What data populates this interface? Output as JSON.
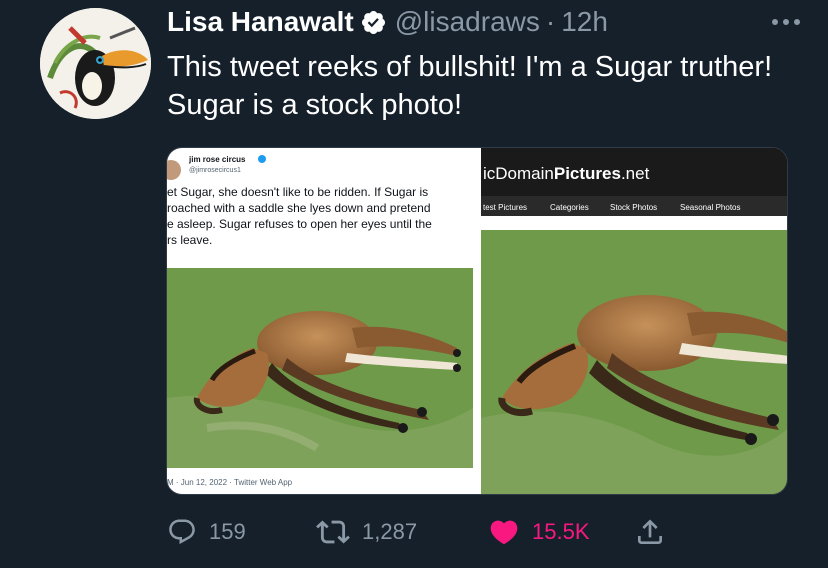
{
  "author": {
    "display_name": "Lisa Hanawalt",
    "handle": "@lisadraws",
    "separator": "·",
    "time": "12h"
  },
  "tweet": {
    "text": "This tweet reeks of bullshit! I'm a Sugar truther! Sugar is a stock photo!"
  },
  "media": {
    "left_panel": {
      "quoted_name": "jim rose circus",
      "quoted_handle": "@jimrosecircus1",
      "quoted_text_lines": [
        "et Sugar, she doesn't like to be ridden. If Sugar is",
        "roached with a saddle she lyes down and pretend",
        "e asleep. Sugar refuses to open her eyes until the",
        "rs leave."
      ],
      "footer": "M · Jun 12, 2022 · Twitter Web App"
    },
    "right_panel": {
      "site_title_prefix": "icDomain",
      "site_title_bold": "Pictures",
      "site_title_suffix": ".net",
      "nav_items": [
        "test Pictures",
        "Categories",
        "Stock Photos",
        "Seasonal Photos"
      ]
    }
  },
  "actions": {
    "reply_count": "159",
    "retweet_count": "1,287",
    "like_count": "15.5K"
  },
  "colors": {
    "background": "#15202b",
    "text": "#ffffff",
    "secondary": "#8b98a5",
    "like": "#f91880",
    "verified": "#1d9bf0"
  },
  "icons": {
    "verified": "verified-badge-icon",
    "more": "more-horizontal-icon",
    "reply": "reply-icon",
    "retweet": "retweet-icon",
    "like": "heart-icon",
    "share": "share-icon"
  }
}
